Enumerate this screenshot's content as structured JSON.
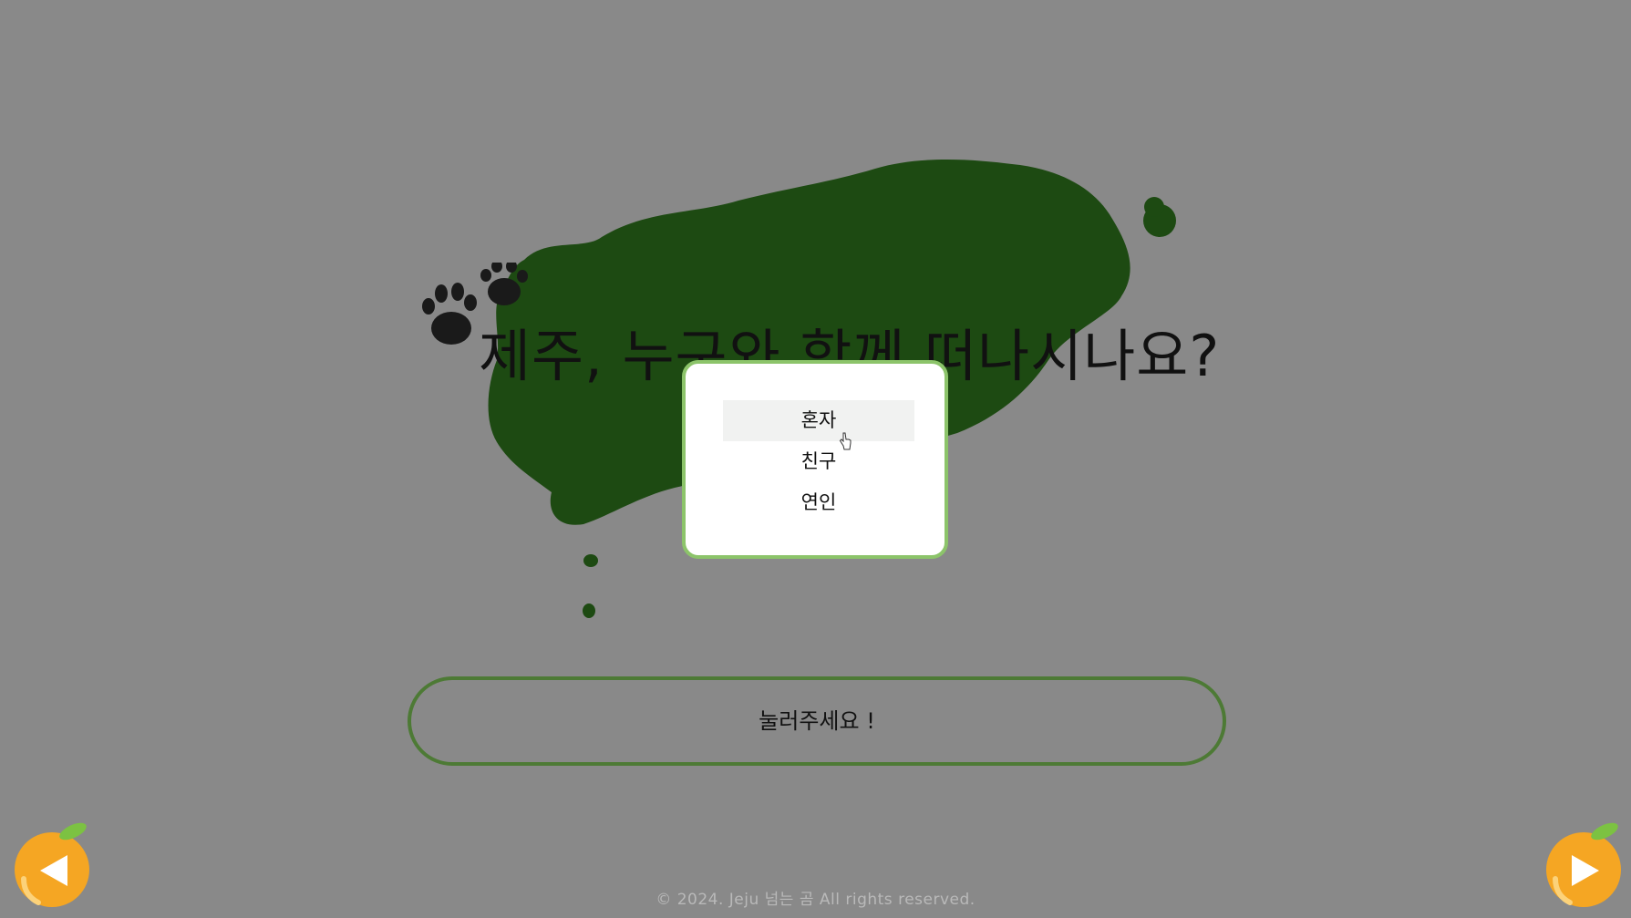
{
  "page": {
    "title": "제주, 누구와 함께 떠나시나요?"
  },
  "dropdown": {
    "options": [
      "혼자",
      "친구",
      "연인"
    ],
    "hovered_option": "혼자"
  },
  "cta": {
    "label": "눌러주세요 !"
  },
  "navigation": {
    "prev_icon": "orange-prev-arrow-icon",
    "next_icon": "orange-next-arrow-icon"
  },
  "footer": {
    "copyright": "© 2024. Jeju 넘는 곰 All rights reserved."
  },
  "colors": {
    "background": "#898989",
    "island": "#1d4a12",
    "dropdown_border": "#8cc46a",
    "cta_border": "#4d7a35",
    "orange": "#f5a623",
    "leaf": "#7cc242"
  }
}
